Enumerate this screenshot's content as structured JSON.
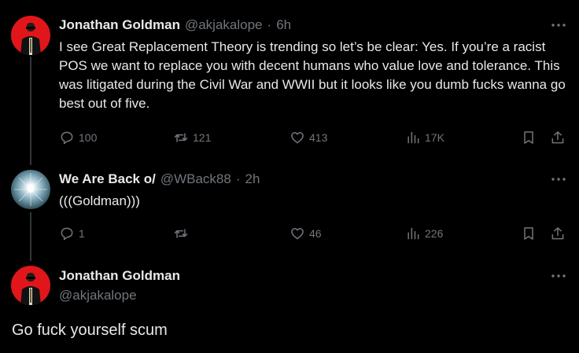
{
  "tweets": [
    {
      "name": "Jonathan Goldman",
      "handle": "@akjakalope",
      "dot": "·",
      "time": "6h",
      "text": "I see Great Replacement Theory is trending so let’s be clear: Yes. If you’re a racist POS we want to replace you with decent humans who value love and tolerance. This was litigated during the Civil War and WWII but it looks like you dumb fucks wanna go best out of five.",
      "replies": "100",
      "reposts": "121",
      "likes": "413",
      "views": "17K"
    },
    {
      "name": "We Are Back o/",
      "handle": "@WBack88",
      "dot": "·",
      "time": "2h",
      "text": "(((Goldman)))",
      "replies": "1",
      "reposts": "",
      "likes": "46",
      "views": "226"
    }
  ],
  "main": {
    "name": "Jonathan Goldman",
    "handle": "@akjakalope",
    "text": "Go fuck yourself scum"
  },
  "colors": {
    "background": "#000000",
    "text": "#e7e9ea",
    "secondary": "#71767b",
    "line": "#333639",
    "avatar_red": "#e0161b"
  },
  "icons": [
    "reply-icon",
    "repost-icon",
    "like-icon",
    "views-icon",
    "bookmark-icon",
    "share-icon",
    "more-icon"
  ]
}
